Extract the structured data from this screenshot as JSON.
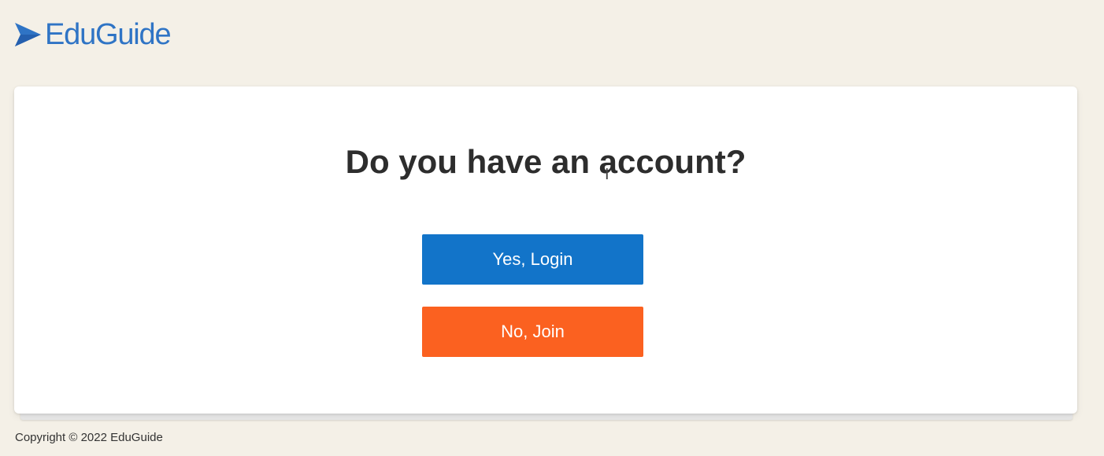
{
  "brand": {
    "name": "EduGuide",
    "logo_icon": "play-triangle-icon",
    "color": "#2f74c5"
  },
  "prompt": {
    "question": "Do you have an account?",
    "cursor_icon": "text-cursor-icon"
  },
  "actions": {
    "login_label": "Yes, Login",
    "login_color": "#1274c9",
    "join_label": "No, Join",
    "join_color": "#fb6120"
  },
  "footer": {
    "copyright": "Copyright © 2022 EduGuide"
  },
  "colors": {
    "background": "#f4f0e7",
    "card": "#ffffff",
    "text": "#2d2d2d"
  }
}
